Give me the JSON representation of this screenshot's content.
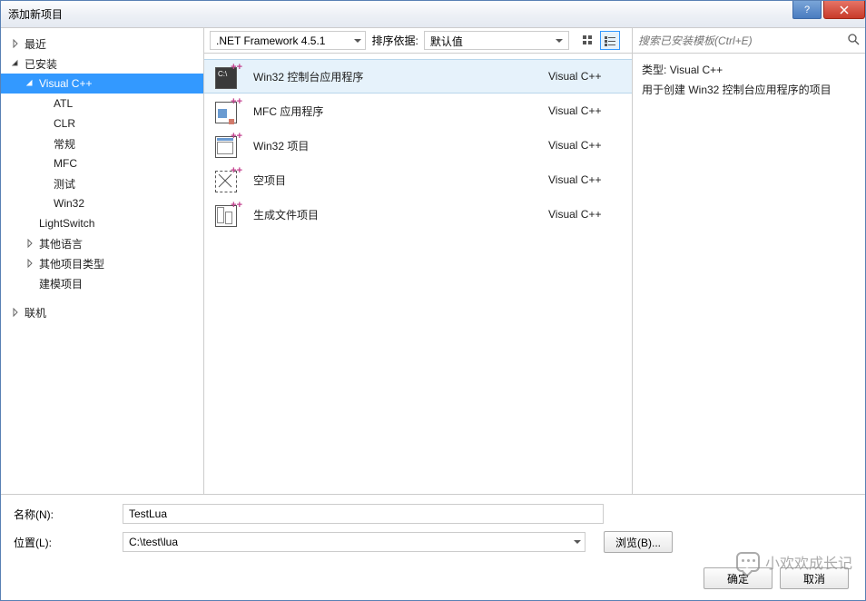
{
  "window": {
    "title": "添加新项目"
  },
  "sidebar": {
    "items": [
      {
        "label": "最近",
        "depth": 1,
        "expandable": true,
        "expanded": false
      },
      {
        "label": "已安装",
        "depth": 1,
        "expandable": true,
        "expanded": true
      },
      {
        "label": "Visual C++",
        "depth": 2,
        "expandable": true,
        "expanded": true,
        "selected": true
      },
      {
        "label": "ATL",
        "depth": 3
      },
      {
        "label": "CLR",
        "depth": 3
      },
      {
        "label": "常规",
        "depth": 3
      },
      {
        "label": "MFC",
        "depth": 3
      },
      {
        "label": "测试",
        "depth": 3
      },
      {
        "label": "Win32",
        "depth": 3
      },
      {
        "label": "LightSwitch",
        "depth": 2,
        "leaf": true
      },
      {
        "label": "其他语言",
        "depth": 2,
        "expandable": true,
        "expanded": false
      },
      {
        "label": "其他项目类型",
        "depth": 2,
        "expandable": true,
        "expanded": false
      },
      {
        "label": "建模项目",
        "depth": 2,
        "leaf": true
      },
      {
        "label": "联机",
        "depth": 1,
        "expandable": true,
        "expanded": false
      }
    ]
  },
  "toolbar": {
    "framework": ".NET Framework 4.5.1",
    "sort_label": "排序依据:",
    "sort_value": "默认值"
  },
  "templates": [
    {
      "name": "Win32 控制台应用程序",
      "lang": "Visual C++",
      "selected": true,
      "icon": "console"
    },
    {
      "name": "MFC 应用程序",
      "lang": "Visual C++",
      "icon": "mfc"
    },
    {
      "name": "Win32 项目",
      "lang": "Visual C++",
      "icon": "win32"
    },
    {
      "name": "空项目",
      "lang": "Visual C++",
      "icon": "empty"
    },
    {
      "name": "生成文件项目",
      "lang": "Visual C++",
      "icon": "makefile"
    }
  ],
  "rightpane": {
    "search_placeholder": "搜索已安装模板(Ctrl+E)",
    "type_label": "类型:",
    "type_value": "Visual C++",
    "description": "用于创建 Win32 控制台应用程序的项目"
  },
  "form": {
    "name_label": "名称(N):",
    "name_value": "TestLua",
    "location_label": "位置(L):",
    "location_value": "C:\\test\\lua",
    "browse_label": "浏览(B)...",
    "ok_label": "确定",
    "cancel_label": "取消"
  },
  "watermark": "小欢欢成长记"
}
